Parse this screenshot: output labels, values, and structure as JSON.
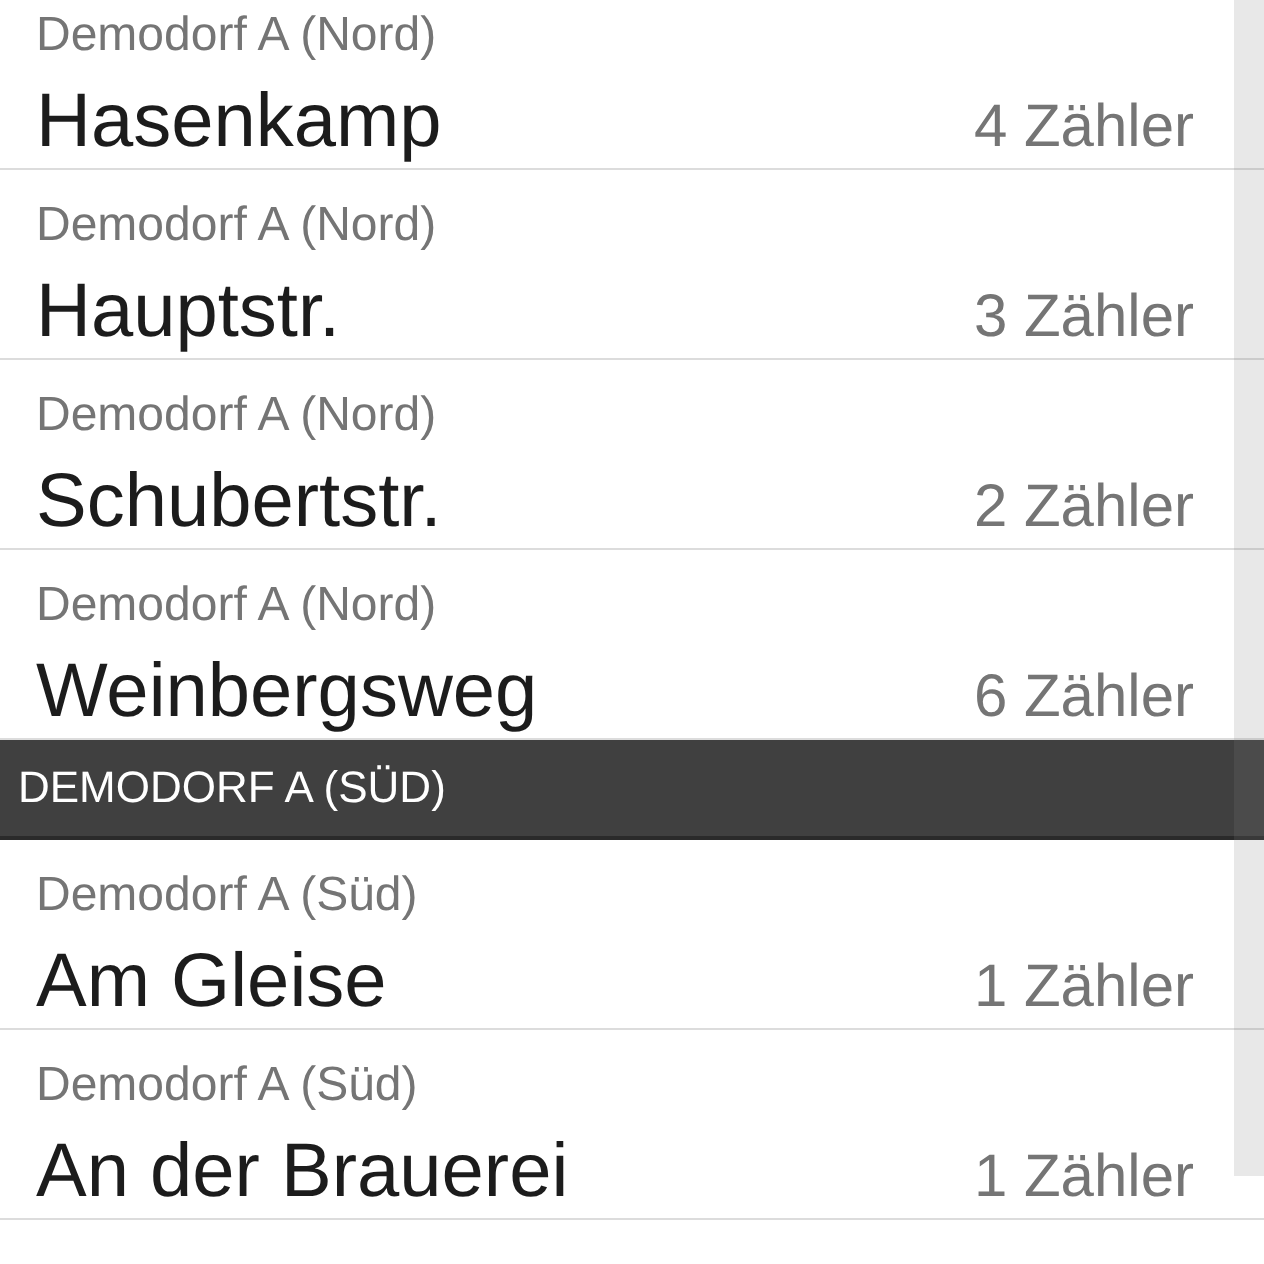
{
  "list": [
    {
      "kind": "street",
      "district": "Demodorf A (Nord)",
      "name": "Hasenkamp",
      "count": "4 Zähler"
    },
    {
      "kind": "street",
      "district": "Demodorf A (Nord)",
      "name": "Hauptstr.",
      "count": "3 Zähler"
    },
    {
      "kind": "street",
      "district": "Demodorf A (Nord)",
      "name": "Schubertstr.",
      "count": "2 Zähler"
    },
    {
      "kind": "street",
      "district": "Demodorf A (Nord)",
      "name": "Weinbergsweg",
      "count": "6 Zähler"
    },
    {
      "kind": "section_header",
      "title": "DEMODORF A (SÜD)"
    },
    {
      "kind": "street",
      "district": "Demodorf A (Süd)",
      "name": "Am Gleise",
      "count": "1 Zähler"
    },
    {
      "kind": "street",
      "district": "Demodorf A (Süd)",
      "name": "An der Brauerei",
      "count": "1 Zähler"
    }
  ]
}
